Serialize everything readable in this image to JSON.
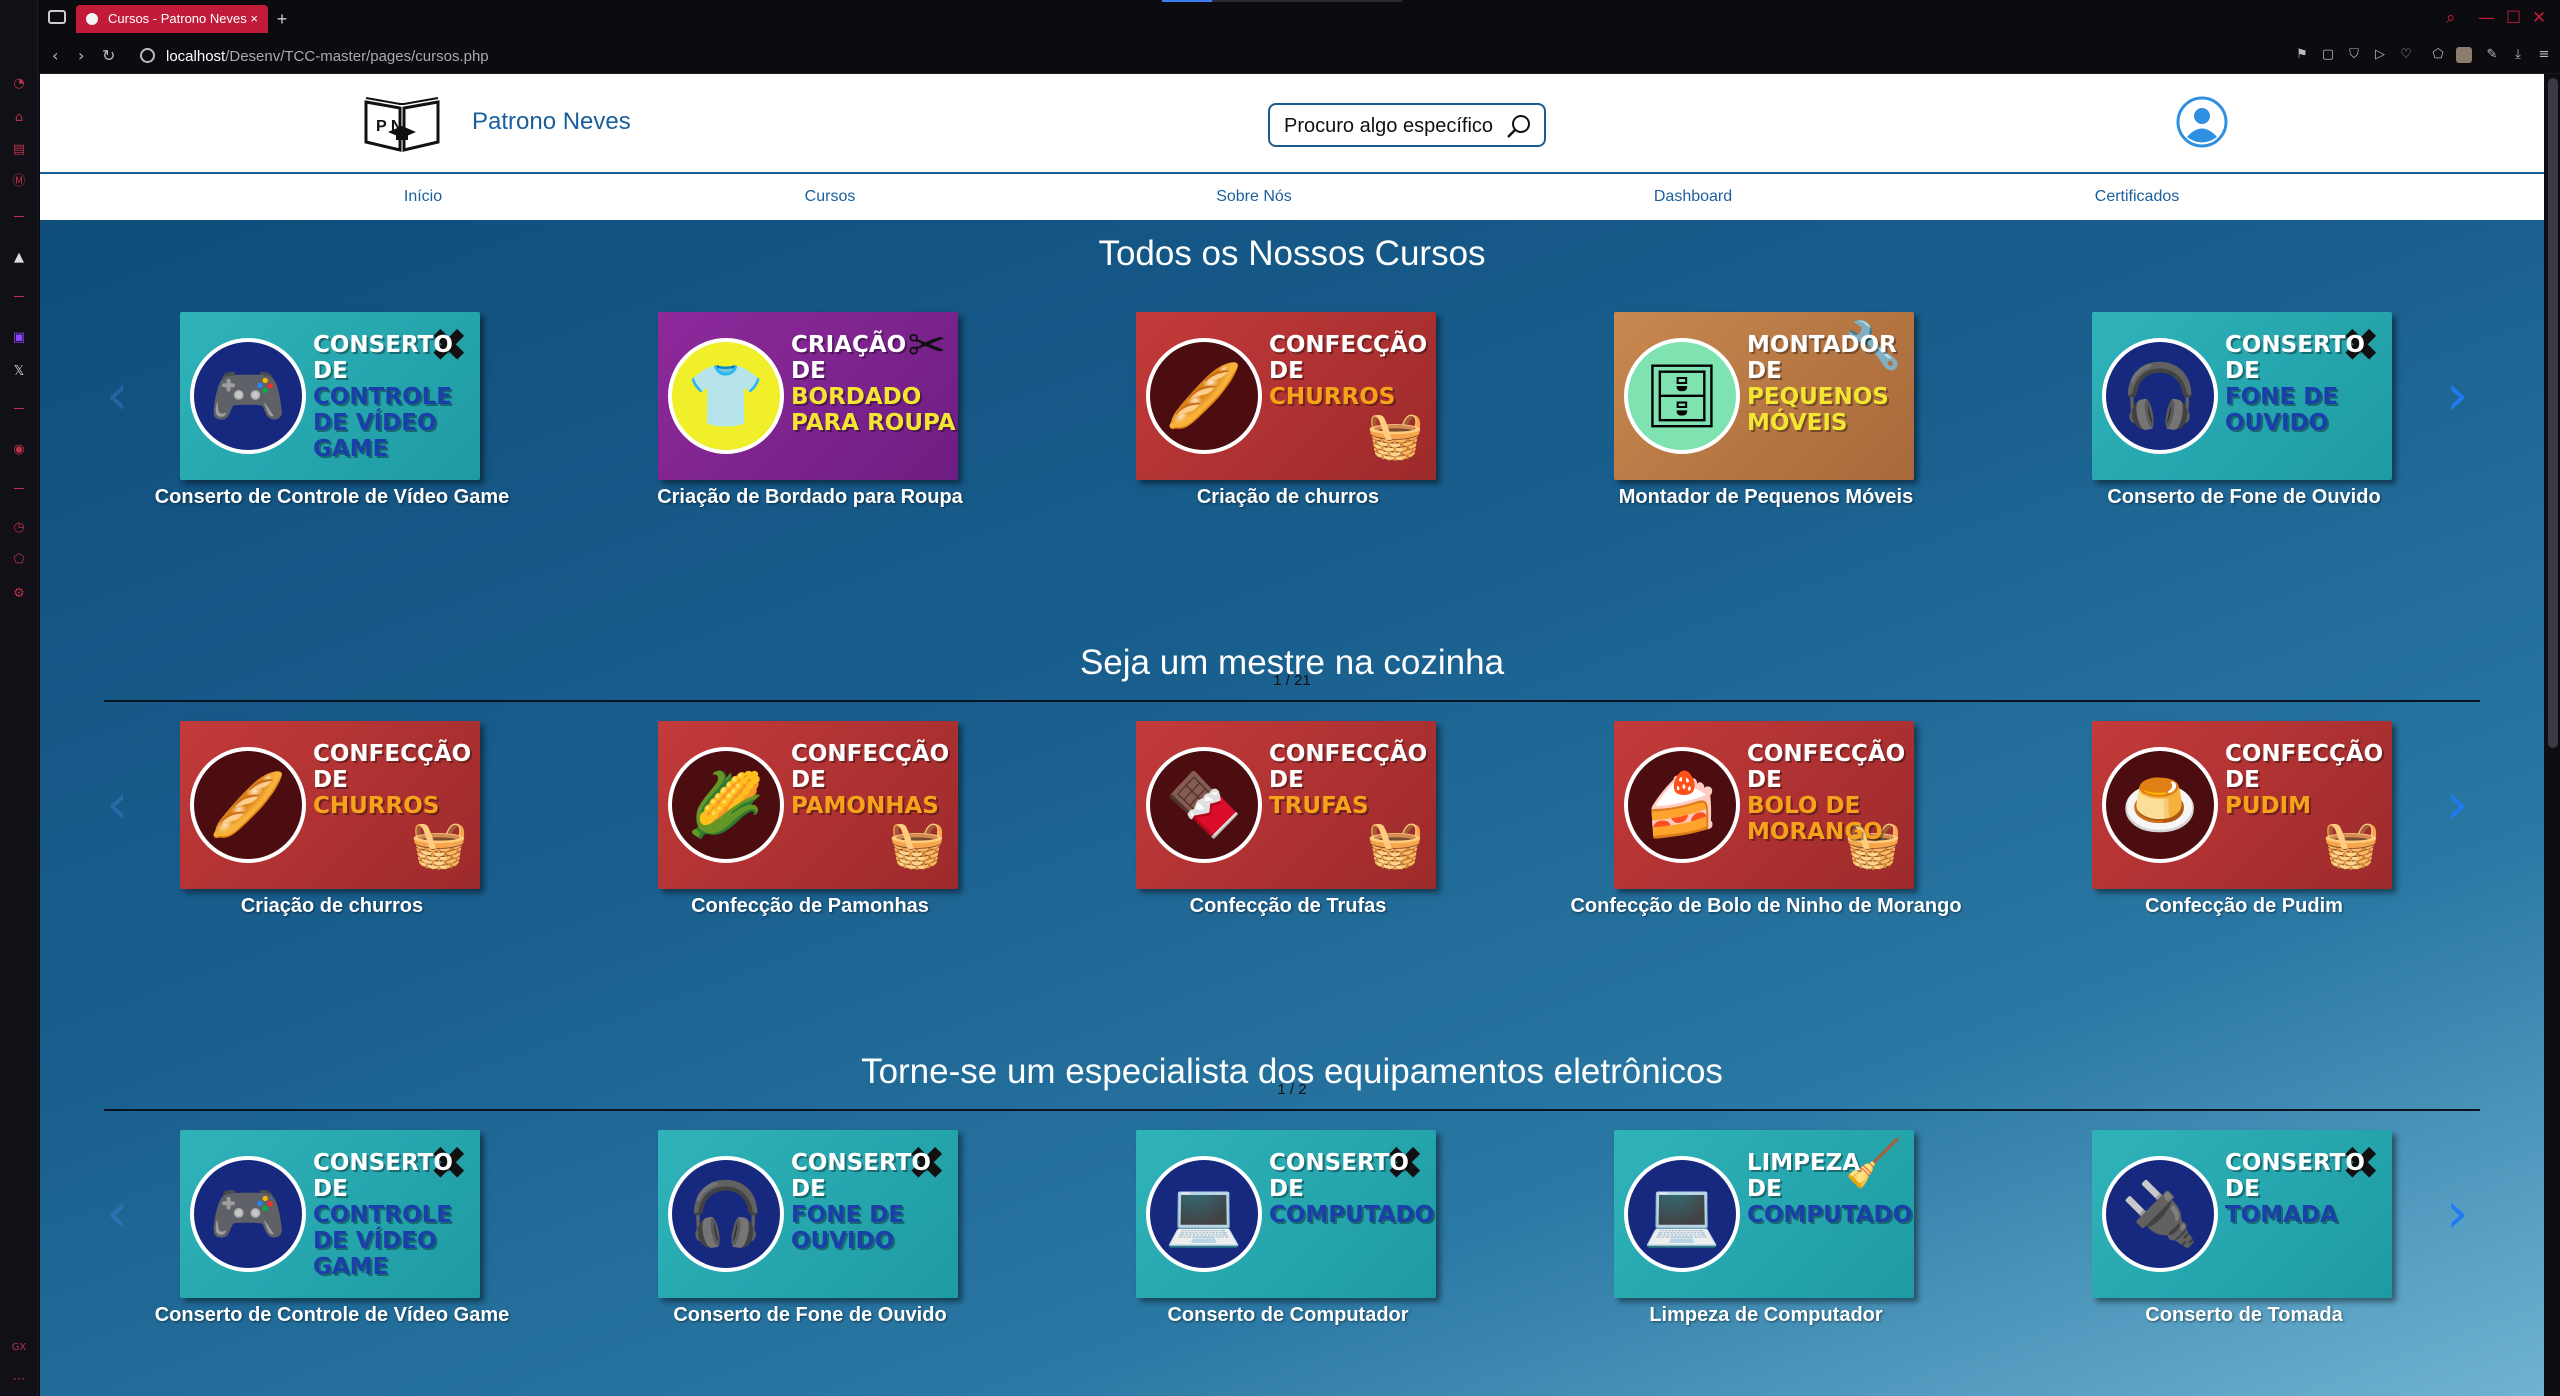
{
  "browser": {
    "tab_title": "Cursos - Patrono Neves",
    "url_host": "localhost",
    "url_path": "/Desenv/TCC-master/pages/cursos.php",
    "sidebar_label": "GX"
  },
  "site": {
    "brand": "Patrono Neves",
    "search_text": "Procuro algo específico",
    "logo_letters": "P N"
  },
  "nav": [
    "Início",
    "Cursos",
    "Sobre Nós",
    "Dashboard",
    "Certificados"
  ],
  "sections": [
    {
      "title": "Todos os Nossos Cursos",
      "counter": "1 / 21",
      "cards": [
        {
          "caption": "Conserto de Controle de Vídeo Game",
          "bg": "teal",
          "circle": "navy",
          "lines": [
            "CONSERTO",
            "DE",
            "CONTROLE",
            "DE VÍDEO",
            "GAME"
          ],
          "icon": "gamepad-icon",
          "glyph": "🎮",
          "deco": "✖"
        },
        {
          "caption": "Criação de Bordado para Roupa",
          "bg": "purple",
          "circle": "yellow",
          "lines": [
            "CRIAÇÃO",
            "DE",
            "BORDADO",
            "PARA ROUPA"
          ],
          "icon": "clothes-icon",
          "glyph": "👕",
          "deco": "✂"
        },
        {
          "caption": "Criação de churros",
          "bg": "red",
          "circle": "maroon",
          "lines": [
            "CONFECÇÃO",
            "DE",
            "CHURROS"
          ],
          "icon": "churros-icon",
          "glyph": "🥖",
          "deco": "🧺"
        },
        {
          "caption": "Montador de Pequenos Móveis",
          "bg": "brown",
          "circle": "mint",
          "lines": [
            "MONTADOR",
            "DE",
            "PEQUENOS",
            "MÓVEIS"
          ],
          "icon": "shelf-icon",
          "glyph": "🗄",
          "deco": "🔧"
        },
        {
          "caption": "Conserto de Fone de Ouvido",
          "bg": "teal",
          "circle": "navy",
          "lines": [
            "CONSERTO",
            "DE",
            "FONE DE",
            "OUVIDO"
          ],
          "icon": "headphones-icon",
          "glyph": "🎧",
          "deco": "✖"
        }
      ]
    },
    {
      "title": "Seja um mestre na cozinha",
      "counter": "1 / 2",
      "cards": [
        {
          "caption": "Criação de churros",
          "bg": "red",
          "circle": "maroon",
          "lines": [
            "CONFECÇÃO",
            "DE",
            "CHURROS"
          ],
          "icon": "churros-icon",
          "glyph": "🥖",
          "deco": "🧺"
        },
        {
          "caption": "Confecção de Pamonhas",
          "bg": "red",
          "circle": "maroon",
          "lines": [
            "CONFECÇÃO",
            "DE",
            "PAMONHAS"
          ],
          "icon": "pamonha-icon",
          "glyph": "🌽",
          "deco": "🧺"
        },
        {
          "caption": "Confecção de Trufas",
          "bg": "red",
          "circle": "maroon",
          "lines": [
            "CONFECÇÃO",
            "DE",
            "TRUFAS"
          ],
          "icon": "truffle-icon",
          "glyph": "🍫",
          "deco": "🧺"
        },
        {
          "caption": "Confecção de Bolo de Ninho de Morango",
          "bg": "red",
          "circle": "maroon",
          "lines": [
            "CONFECÇÃO",
            "DE",
            "BOLO DE",
            "MORANGO"
          ],
          "icon": "cake-icon",
          "glyph": "🍰",
          "deco": "🧺"
        },
        {
          "caption": "Confecção de Pudim",
          "bg": "red",
          "circle": "maroon",
          "lines": [
            "CONFECÇÃO",
            "DE",
            "PUDIM"
          ],
          "icon": "pudding-icon",
          "glyph": "🍮",
          "deco": "🧺"
        }
      ]
    },
    {
      "title": "Torne-se um especialista dos equipamentos eletrônicos",
      "counter": "",
      "cards": [
        {
          "caption": "Conserto de Controle de Vídeo Game",
          "bg": "teal",
          "circle": "navy",
          "lines": [
            "CONSERTO",
            "DE",
            "CONTROLE",
            "DE VÍDEO",
            "GAME"
          ],
          "icon": "gamepad-icon",
          "glyph": "🎮",
          "deco": "✖"
        },
        {
          "caption": "Conserto de Fone de Ouvido",
          "bg": "teal",
          "circle": "navy",
          "lines": [
            "CONSERTO",
            "DE",
            "FONE DE",
            "OUVIDO"
          ],
          "icon": "headphones-icon",
          "glyph": "🎧",
          "deco": "✖"
        },
        {
          "caption": "Conserto de Computador",
          "bg": "teal",
          "circle": "navy",
          "lines": [
            "CONSERTO",
            "DE",
            "COMPUTADOR"
          ],
          "icon": "laptop-icon",
          "glyph": "💻",
          "deco": "✖"
        },
        {
          "caption": "Limpeza de Computador",
          "bg": "teal",
          "circle": "navy",
          "lines": [
            "LIMPEZA",
            "DE",
            "COMPUTADOR"
          ],
          "icon": "laptop-icon",
          "glyph": "💻",
          "deco": "🧹"
        },
        {
          "caption": "Conserto de Tomada",
          "bg": "teal",
          "circle": "navy",
          "lines": [
            "CONSERTO",
            "DE",
            "TOMADA"
          ],
          "icon": "outlet-icon",
          "glyph": "🔌",
          "deco": "✖"
        }
      ]
    }
  ],
  "colors": {
    "brand": "#1a5f9c",
    "tab": "#c21b3a",
    "arrow": "#1f7bf2",
    "highlight_orange": "#f7a21b",
    "highlight_blue": "#1b3fa8",
    "highlight_yellow": "#f3e531"
  }
}
